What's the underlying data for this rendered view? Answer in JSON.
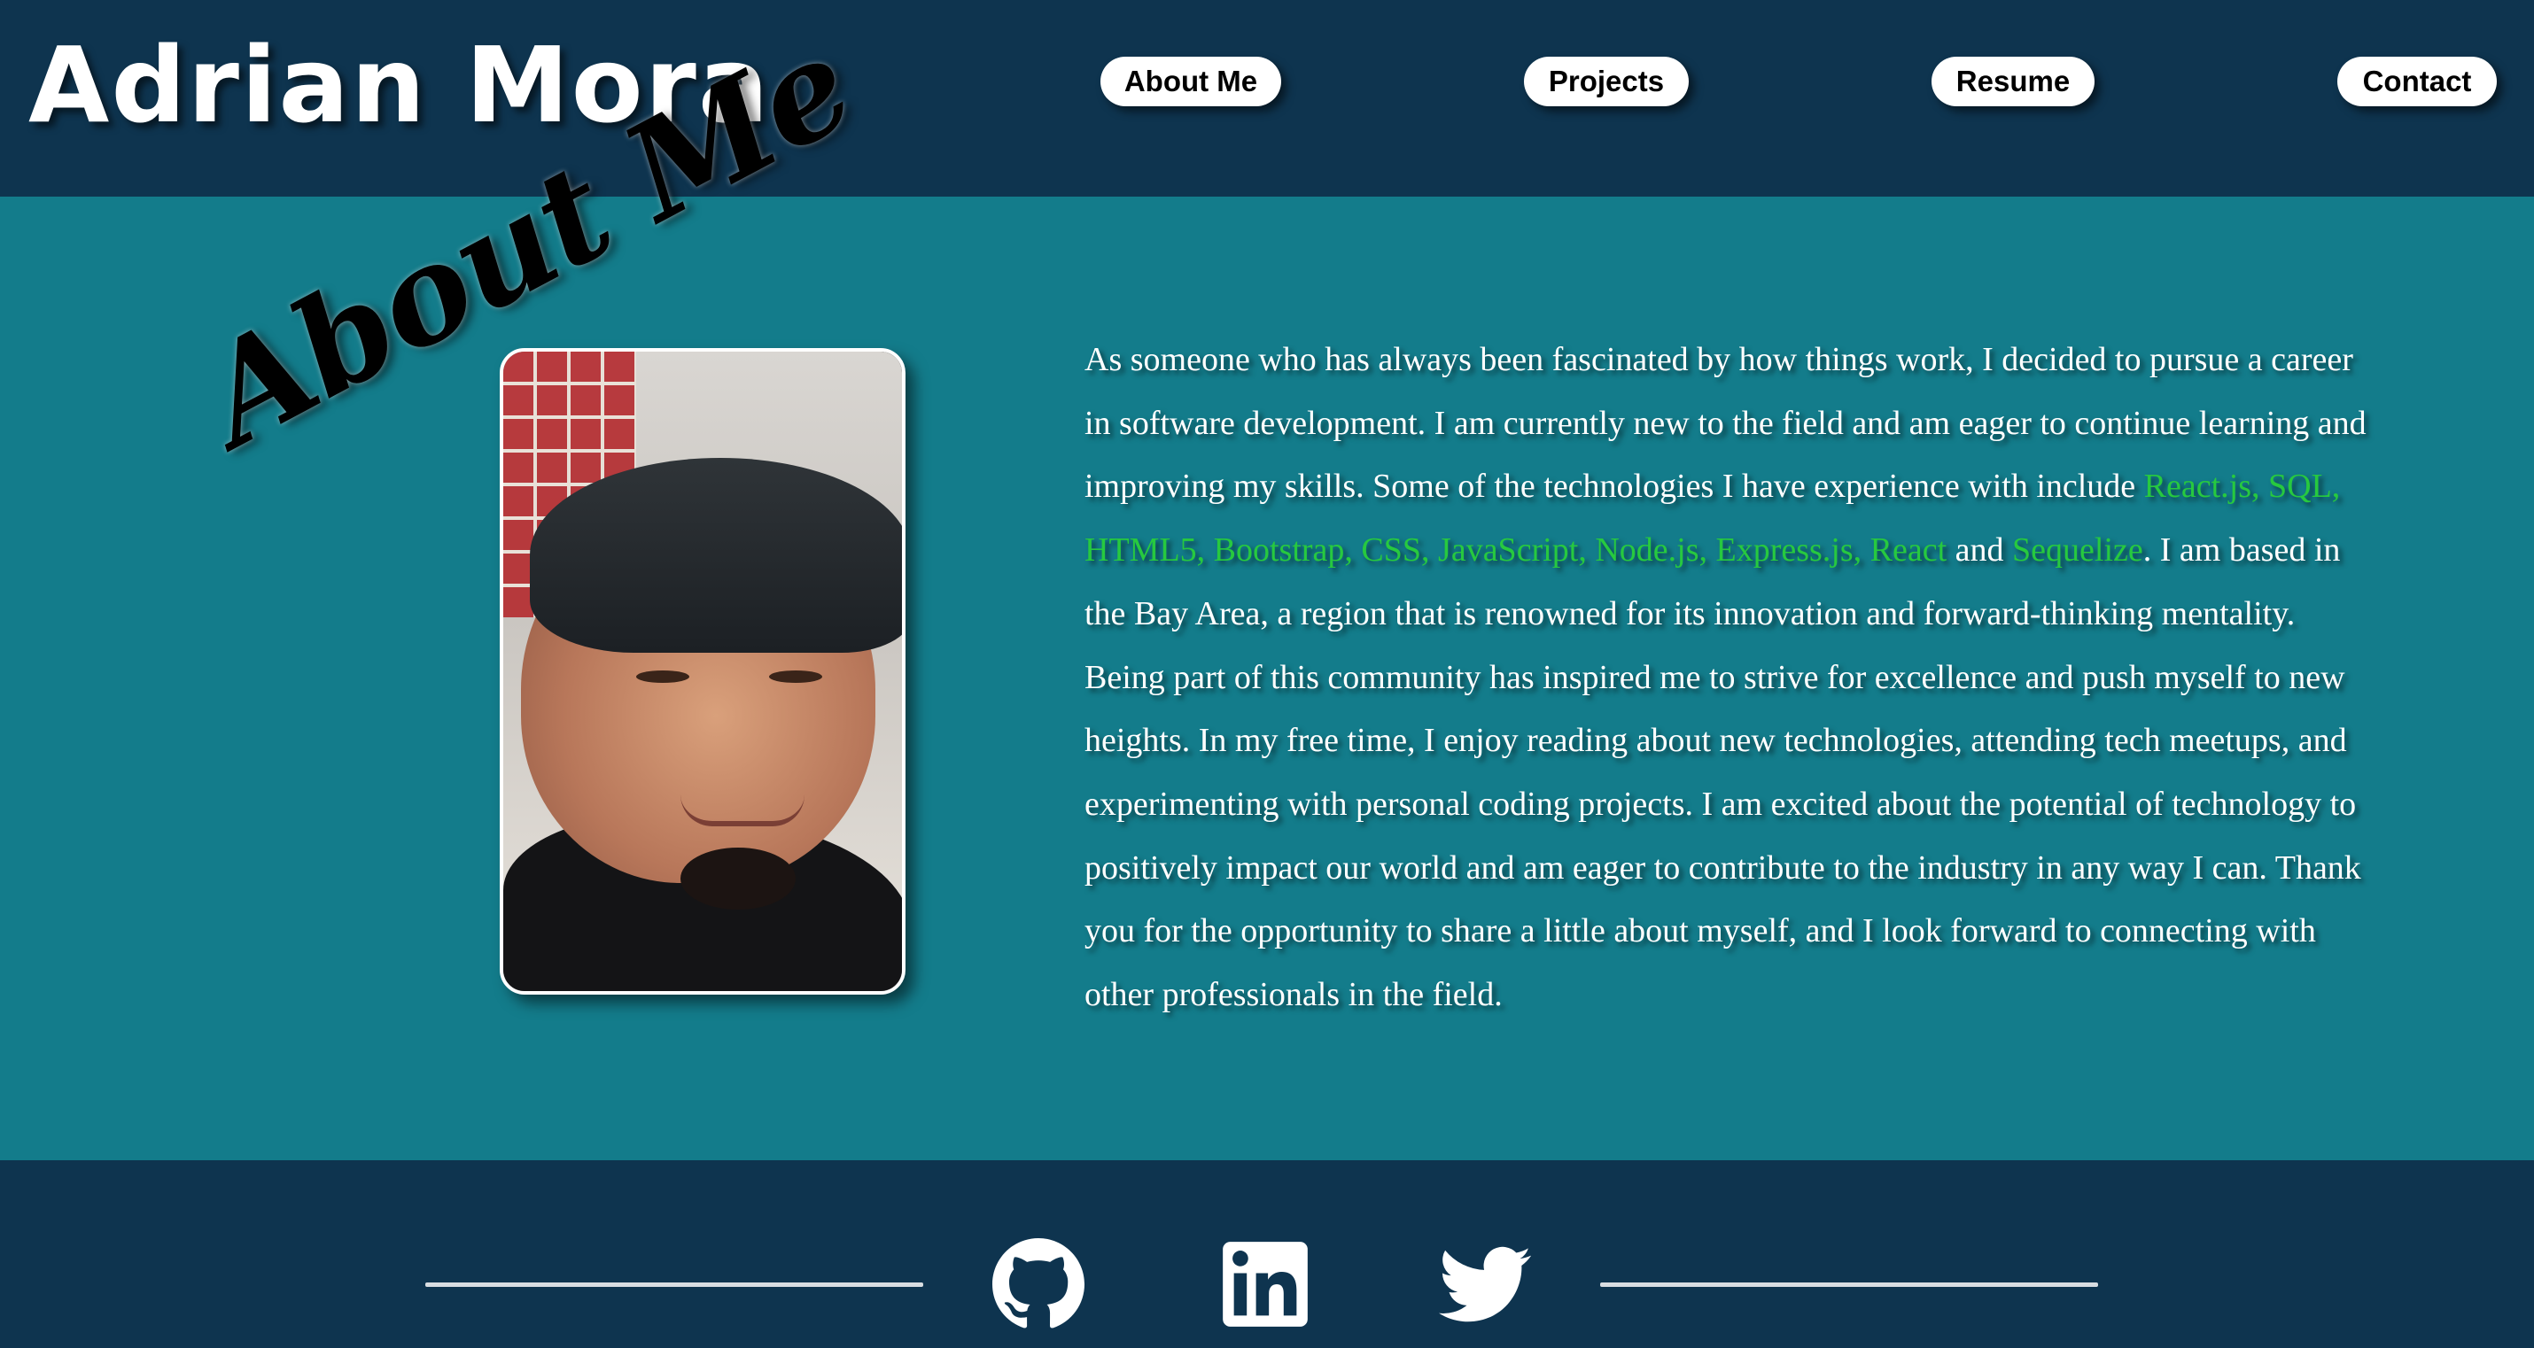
{
  "header": {
    "brand": "Adrian Mora",
    "nav": {
      "about": "About Me",
      "projects": "Projects",
      "resume": "Resume",
      "contact": "Contact"
    }
  },
  "about": {
    "heading": "About Me",
    "bio": {
      "part1": "As someone who has always been fascinated by how things work, I decided to pursue a career in software development. I am currently new to the field and am eager to continue learning and improving my skills. Some of the technologies I have experience with include ",
      "tech1": "React.js, SQL, HTML5, Bootstrap, CSS, JavaScript, Node.js, Express.js, React",
      "part2": " and ",
      "tech2": "Sequelize",
      "part3": ". I am based in the Bay Area, a region that is renowned for its innovation and forward-thinking mentality. Being part of this community has inspired me to strive for excellence and push myself to new heights. In my free time, I enjoy reading about new technologies, attending tech meetups, and experimenting with personal coding projects. I am excited about the potential of technology to positively impact our world and am eager to contribute to the industry in any way I can. Thank you for the opportunity to share a little about myself, and I look forward to connecting with other professionals in the field."
    }
  },
  "footer": {
    "icons": [
      "github-icon",
      "linkedin-icon",
      "twitter-icon"
    ]
  },
  "colors": {
    "header_bg": "#0e344f",
    "main_bg": "#137c8b",
    "tech_highlight": "#27c93f",
    "text": "#ffffff"
  }
}
